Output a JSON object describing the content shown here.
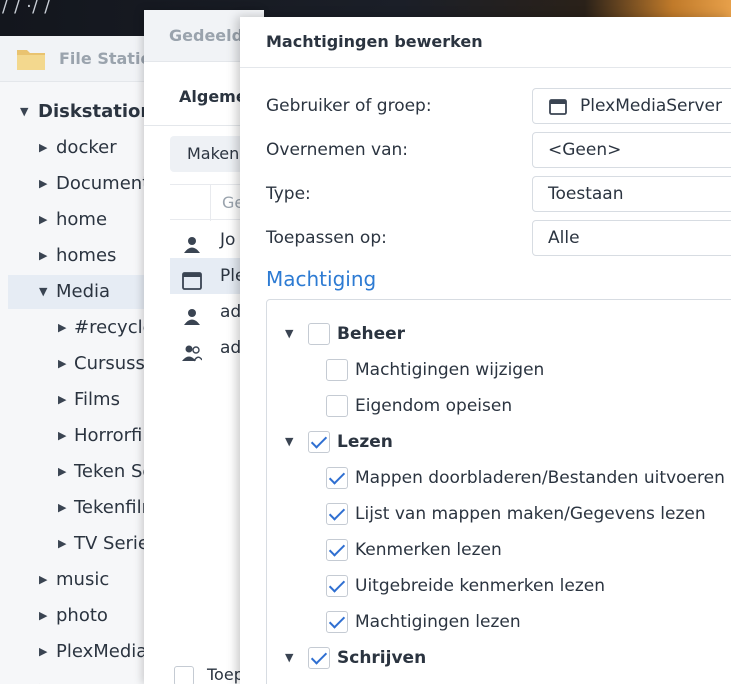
{
  "wallpaper": {
    "text": "/ / ·/ / "
  },
  "file_station": {
    "title": "File Statio",
    "tree": [
      {
        "label": "Diskstation",
        "expanded": true,
        "bold": true
      },
      {
        "label": "docker"
      },
      {
        "label": "Documents"
      },
      {
        "label": "home"
      },
      {
        "label": "homes"
      },
      {
        "label": "Media",
        "expanded": true,
        "selected": true
      },
      {
        "label": "#recycle"
      },
      {
        "label": "Cursussen"
      },
      {
        "label": "Films"
      },
      {
        "label": "Horrorfilms"
      },
      {
        "label": "Teken Se"
      },
      {
        "label": "Tekenfilms"
      },
      {
        "label": "TV Series"
      },
      {
        "label": "music"
      },
      {
        "label": "photo"
      },
      {
        "label": "PlexMediaS"
      },
      {
        "label": "··· "
      }
    ]
  },
  "shared_window": {
    "title": "Gedeeld",
    "tab": "Algeme",
    "create_button": "Maken",
    "column_header": "Ge",
    "rows": [
      {
        "icon": "user-icon",
        "label": "Jo"
      },
      {
        "icon": "app-window-icon",
        "label": "Ple",
        "selected": true
      },
      {
        "icon": "user-icon",
        "label": "ad"
      },
      {
        "icon": "group-icon",
        "label": "ad"
      }
    ],
    "bottom_label": "Toep"
  },
  "dialog": {
    "title": "Machtigingen bewerken",
    "fields": {
      "user_label": "Gebruiker of groep:",
      "user_value": "PlexMediaServer",
      "inherit_label": "Overnemen van:",
      "inherit_value": "<Geen>",
      "type_label": "Type:",
      "type_value": "Toestaan",
      "apply_label": "Toepassen op:",
      "apply_value": "Alle"
    },
    "permission_title": "Machtiging",
    "groups": [
      {
        "label": "Beheer",
        "checked": false,
        "items": [
          {
            "label": "Machtigingen wijzigen",
            "checked": false
          },
          {
            "label": "Eigendom opeisen",
            "checked": false
          }
        ]
      },
      {
        "label": "Lezen",
        "checked": true,
        "items": [
          {
            "label": "Mappen doorbladeren/Bestanden uitvoeren",
            "checked": true
          },
          {
            "label": "Lijst van mappen maken/Gegevens lezen",
            "checked": true
          },
          {
            "label": "Kenmerken lezen",
            "checked": true
          },
          {
            "label": "Uitgebreide kenmerken lezen",
            "checked": true
          },
          {
            "label": "Machtigingen lezen",
            "checked": true
          }
        ]
      },
      {
        "label": "Schrijven",
        "checked": true,
        "items": []
      }
    ]
  },
  "colors": {
    "accent": "#2d7bd3",
    "check": "#2f6fd1",
    "selected_row": "#e6ecf4"
  }
}
